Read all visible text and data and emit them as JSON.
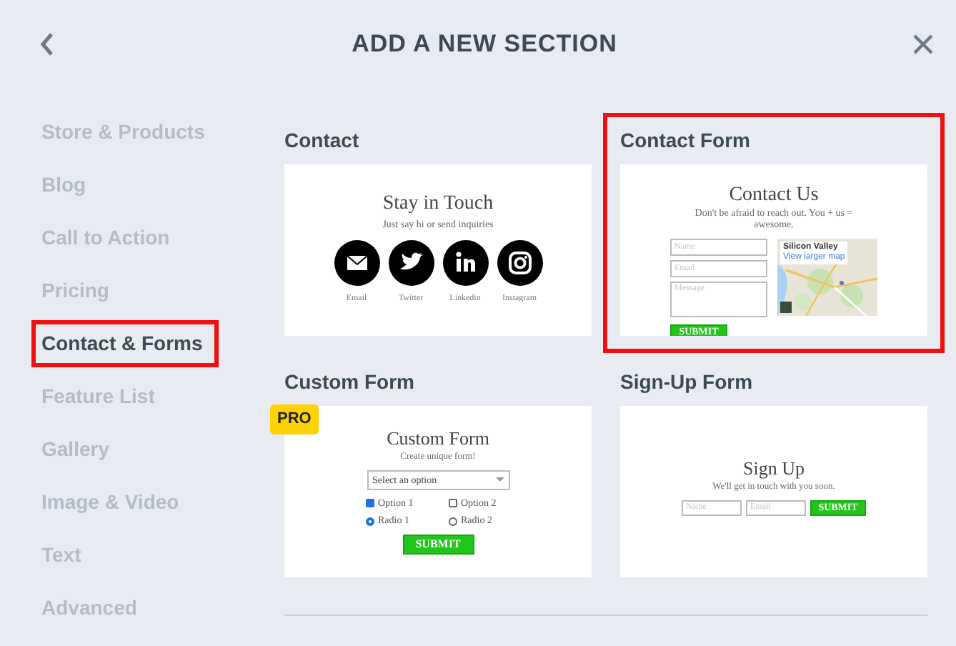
{
  "header": {
    "title": "ADD A NEW SECTION"
  },
  "sidebar": {
    "items": [
      {
        "label": "Store & Products",
        "selected": false
      },
      {
        "label": "Blog",
        "selected": false
      },
      {
        "label": "Call to Action",
        "selected": false
      },
      {
        "label": "Pricing",
        "selected": false
      },
      {
        "label": "Contact & Forms",
        "selected": true
      },
      {
        "label": "Feature List",
        "selected": false
      },
      {
        "label": "Gallery",
        "selected": false
      },
      {
        "label": "Image & Video",
        "selected": false
      },
      {
        "label": "Text",
        "selected": false
      },
      {
        "label": "Advanced",
        "selected": false
      }
    ]
  },
  "sections": [
    {
      "title": "Contact",
      "selected": false,
      "kind": "contact",
      "heading": "Stay in Touch",
      "subtitle": "Just say hi or send inquiries",
      "social": [
        {
          "kind": "email",
          "label": "Email"
        },
        {
          "kind": "twitter",
          "label": "Twitter"
        },
        {
          "kind": "linkedin",
          "label": "Linkedin"
        },
        {
          "kind": "instagram",
          "label": "Instagram"
        }
      ]
    },
    {
      "title": "Contact Form",
      "selected": true,
      "kind": "contact_form",
      "heading": "Contact Us",
      "subtitle": "Don't be afraid to reach out. You + us = awesome.",
      "fields": [
        "Name",
        "Email",
        "Message"
      ],
      "button": "SUBMIT",
      "map": {
        "place": "Silicon Valley",
        "link": "View larger map"
      }
    },
    {
      "title": "Custom Form",
      "selected": false,
      "kind": "custom_form",
      "badge": "PRO",
      "heading": "Custom Form",
      "subtitle": "Create unique form!",
      "select": "Select an option",
      "options": [
        {
          "kind": "checkbox",
          "label": "Option 1",
          "checked": true
        },
        {
          "kind": "checkbox",
          "label": "Option 2",
          "checked": false
        },
        {
          "kind": "radio",
          "label": "Radio 1",
          "checked": true
        },
        {
          "kind": "radio",
          "label": "Radio 2",
          "checked": false
        }
      ],
      "button": "SUBMIT"
    },
    {
      "title": "Sign-Up Form",
      "selected": false,
      "kind": "signup",
      "heading": "Sign Up",
      "subtitle": "We'll get in touch with you soon.",
      "fields": [
        "Name",
        "Email"
      ],
      "button": "SUBMIT"
    }
  ]
}
